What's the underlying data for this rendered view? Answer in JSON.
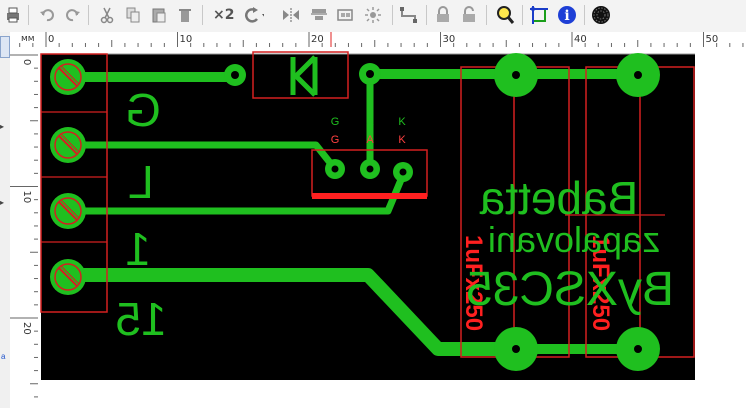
{
  "toolbar": {
    "zoom_factor_label": "×2",
    "buttons": [
      "printer-icon",
      "undo-icon",
      "redo-icon",
      "cut-icon",
      "copy-icon",
      "paste-icon",
      "delete-icon",
      "zoom-factor",
      "rotate-icon",
      "mirror-icon",
      "align-icon",
      "group-icon",
      "explode-icon",
      "route-icon",
      "lock-icon",
      "unlock-icon",
      "zoom-icon",
      "snap-icon",
      "info-icon",
      "ground-plane-icon"
    ]
  },
  "ruler": {
    "unit": "мм",
    "h_ticks": [
      "0",
      "10",
      "20",
      "30",
      "40",
      "50"
    ],
    "v_ticks": [
      "0",
      "10",
      "20"
    ]
  },
  "pcb": {
    "terminal_labels": [
      "G",
      "L",
      "1",
      "15"
    ],
    "transistor_pin_labels": {
      "g": "G",
      "a": "A",
      "k": "K"
    },
    "board_text": {
      "line1": "Babetta",
      "line2": "zapalovani",
      "line3": "ByXSC35"
    },
    "capacitor_labels": [
      "1uFx250",
      "1uFx250"
    ],
    "colors": {
      "board": "#000000",
      "copper": "#1fbf1f",
      "outline": "#d42020",
      "silkscreen": "#ff0000"
    }
  }
}
